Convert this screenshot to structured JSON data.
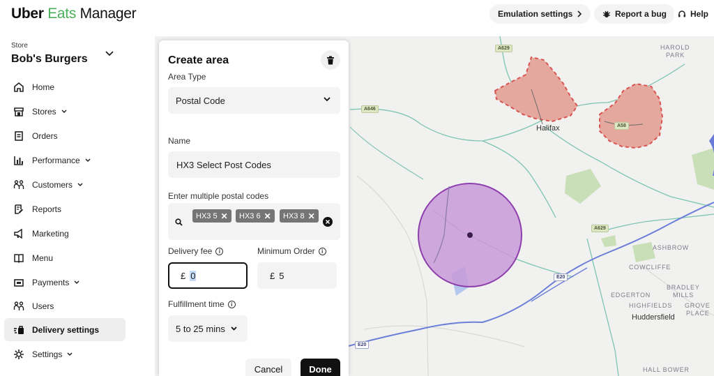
{
  "header": {
    "logo": {
      "part1": "Uber",
      "part2": "Eats",
      "part3": "Manager"
    },
    "emulation_label": "Emulation settings",
    "report_bug_label": "Report a bug",
    "help_label": "Help"
  },
  "sidebar": {
    "store_label": "Store",
    "store_name": "Bob's Burgers",
    "items": [
      {
        "label": "Home"
      },
      {
        "label": "Stores"
      },
      {
        "label": "Orders"
      },
      {
        "label": "Performance"
      },
      {
        "label": "Customers"
      },
      {
        "label": "Reports"
      },
      {
        "label": "Marketing"
      },
      {
        "label": "Menu"
      },
      {
        "label": "Payments"
      },
      {
        "label": "Users"
      },
      {
        "label": "Delivery settings"
      },
      {
        "label": "Settings"
      }
    ]
  },
  "panel": {
    "title": "Create area",
    "area_type_label": "Area Type",
    "area_type_value": "Postal Code",
    "name_label": "Name",
    "name_value": "HX3 Select Post Codes",
    "postal_label": "Enter multiple postal codes",
    "postal_codes": [
      "HX3 5",
      "HX3 6",
      "HX3 8"
    ],
    "delivery_fee_label": "Delivery fee",
    "delivery_fee_currency": "£",
    "delivery_fee_value": "0",
    "min_order_label": "Minimum Order",
    "min_order_currency": "£",
    "min_order_value": "5",
    "fulfillment_label": "Fulfillment time",
    "fulfillment_value": "5 to 25 mins",
    "cancel_label": "Cancel",
    "done_label": "Done"
  },
  "map": {
    "place_labels": [
      "HAROLD",
      "PARK",
      "ASHBROW",
      "COWCLIFFE",
      "BRADLEY",
      "MILLS",
      "EDGERTON",
      "HIGHFIELDS",
      "GROVE",
      "PLACE",
      "HALL BOWER"
    ],
    "cities": [
      "Halifax",
      "Huddersfield"
    ],
    "roads": [
      "A629",
      "A646",
      "A58",
      "A629",
      "E20",
      "E20"
    ],
    "colors": {
      "postal_area_fill": "#e5a89e",
      "postal_area_border": "#d9534f",
      "radius_fill": "#c89ad8",
      "radius_border": "#8e3fae"
    }
  }
}
